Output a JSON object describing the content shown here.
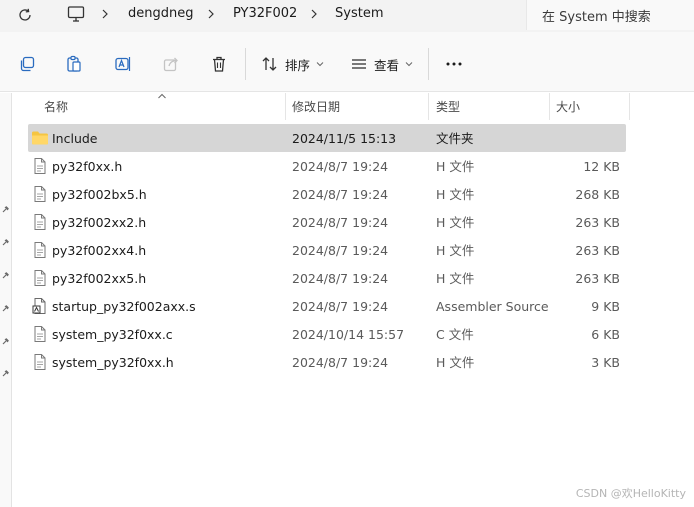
{
  "breadcrumb": [
    "dengdneg",
    "PY32F002",
    "System"
  ],
  "search": {
    "placeholder": "在 System 中搜索"
  },
  "toolbar": {
    "sort_label": "排序",
    "view_label": "查看",
    "more_label": "···"
  },
  "columns": {
    "name": "名称",
    "date": "修改日期",
    "type": "类型",
    "size": "大小"
  },
  "files": [
    {
      "name": "Include",
      "date": "2024/11/5 15:13",
      "type": "文件夹",
      "size": "",
      "icon": "folder-icon"
    },
    {
      "name": "py32f0xx.h",
      "date": "2024/8/7 19:24",
      "type": "H 文件",
      "size": "12 KB",
      "icon": "file-icon"
    },
    {
      "name": "py32f002bx5.h",
      "date": "2024/8/7 19:24",
      "type": "H 文件",
      "size": "268 KB",
      "icon": "file-icon"
    },
    {
      "name": "py32f002xx2.h",
      "date": "2024/8/7 19:24",
      "type": "H 文件",
      "size": "263 KB",
      "icon": "file-icon"
    },
    {
      "name": "py32f002xx4.h",
      "date": "2024/8/7 19:24",
      "type": "H 文件",
      "size": "263 KB",
      "icon": "file-icon"
    },
    {
      "name": "py32f002xx5.h",
      "date": "2024/8/7 19:24",
      "type": "H 文件",
      "size": "263 KB",
      "icon": "file-icon"
    },
    {
      "name": "startup_py32f002axx.s",
      "date": "2024/8/7 19:24",
      "type": "Assembler Source",
      "size": "9 KB",
      "icon": "assembler-file-icon"
    },
    {
      "name": "system_py32f0xx.c",
      "date": "2024/10/14 15:57",
      "type": "C 文件",
      "size": "6 KB",
      "icon": "file-icon"
    },
    {
      "name": "system_py32f0xx.h",
      "date": "2024/8/7 19:24",
      "type": "H 文件",
      "size": "3 KB",
      "icon": "file-icon"
    }
  ],
  "watermark": "CSDN @欢HelloKitty",
  "colors": {
    "selected_row": "#d6d6d6",
    "folder": "#f5c542",
    "toolbar_bg": "#f9f9f9"
  }
}
